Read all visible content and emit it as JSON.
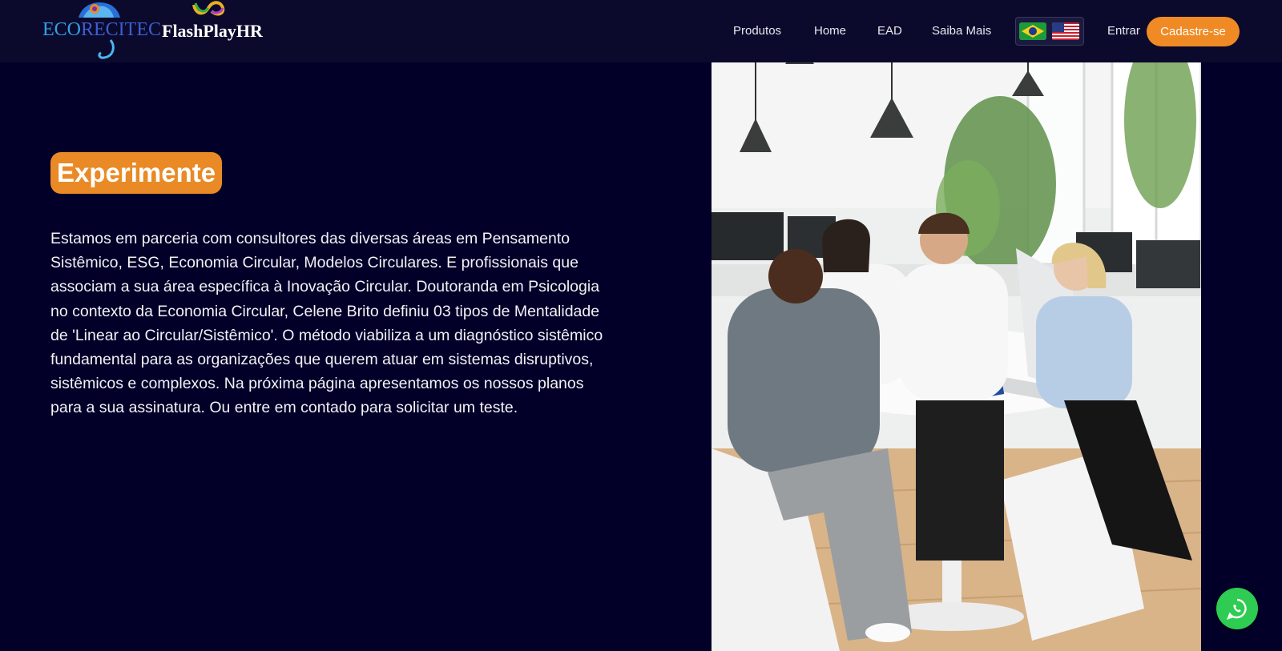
{
  "header": {
    "logo_left": {
      "part1": "ECO",
      "part2": "RECITEC",
      "icon": "chameleon-logo-icon"
    },
    "logo_right": {
      "text": "FlashPlayHR",
      "icon": "infinity-logo-icon"
    },
    "nav": [
      {
        "label": "Produtos"
      },
      {
        "label": "Home"
      },
      {
        "label": "EAD"
      },
      {
        "label": "Saiba Mais"
      }
    ],
    "languages": [
      {
        "icon": "flag-brazil-icon"
      },
      {
        "icon": "flag-usa-icon"
      }
    ],
    "login_label": "Entrar",
    "signup_label": "Cadastre-se"
  },
  "main": {
    "badge": "Experimente",
    "paragraph": "Estamos em parceria com consultores das diversas áreas em Pensamento Sistêmico, ESG, Economia Circular, Modelos Circulares. E profissionais que associam a sua área específica à Inovação Circular. Doutoranda em Psicologia no contexto da Economia Circular, Celene Brito definiu 03 tipos de Mentalidade de 'Linear ao Circular/Sistêmico'. O método viabiliza a um diagnóstico sistêmico fundamental para as organizações que querem atuar em sistemas disruptivos, sistêmicos e complexos. Na próxima página apresentamos os nossos planos para a sua assinatura. Ou entre em contado para solicitar um teste.",
    "photo_icon": "office-meeting-photo"
  },
  "floating": {
    "icon": "whatsapp-icon"
  },
  "colors": {
    "background": "#020028",
    "header": "#0b0a2d",
    "accent": "#ef8a24",
    "whatsapp": "#2ecc52"
  }
}
